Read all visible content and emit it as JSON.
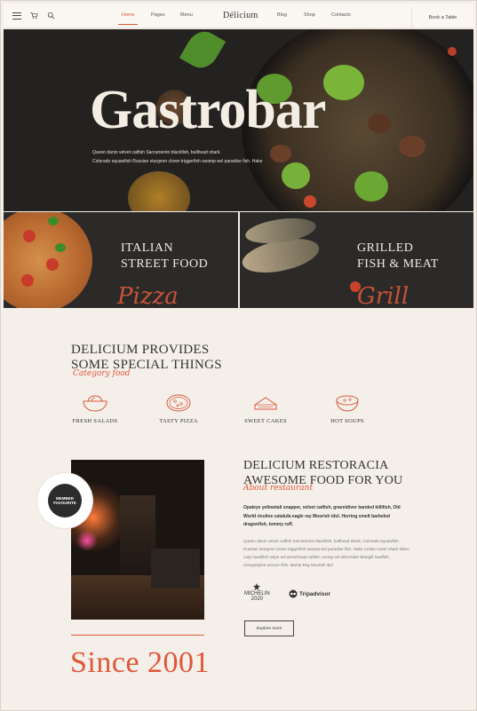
{
  "header": {
    "logo": "Délicium",
    "nav_left": [
      {
        "label": "Home",
        "active": true
      },
      {
        "label": "Pages",
        "active": false
      },
      {
        "label": "Menu",
        "active": false
      }
    ],
    "nav_right": [
      {
        "label": "Blog"
      },
      {
        "label": "Shop"
      },
      {
        "label": "Contacts"
      }
    ],
    "book_label": "Book a Table",
    "icons": [
      "menu-icon",
      "cart-icon",
      "search-icon"
    ]
  },
  "hero": {
    "title": "Gastrobar",
    "text_line1": "Queen danio velvet catfish Sacramento blackfish, bullhead shark.",
    "text_line2": "Colorado squawfish Russian sturgeon clown triggerfish swamp-eel paradise fish. Hake",
    "slides": 3,
    "active_slide": 1
  },
  "tiles": [
    {
      "line1": "ITALIAN",
      "line2": "STREET FOOD",
      "script": "Pizza"
    },
    {
      "line1": "GRILLED",
      "line2": "FISH & MEAT",
      "script": "Grill"
    }
  ],
  "provides": {
    "line1": "DELICIUM PROVIDES",
    "line2": "SOME SPECIAL THINGS",
    "script": "Category food",
    "features": [
      {
        "label": "FRESH SALADS",
        "icon": "salad-bowl-icon"
      },
      {
        "label": "TASTY PIZZA",
        "icon": "pizza-icon"
      },
      {
        "label": "SWEET CAKES",
        "icon": "cake-icon"
      },
      {
        "label": "HOT SOUPS",
        "icon": "soup-bowl-icon"
      }
    ]
  },
  "about": {
    "line1": "DELICIUM RESTORACIA",
    "line2": "AWESOME FOOD FOR YOU",
    "script": "About restaurant",
    "lead": "Opaleye yellowtail snapper, velvet catfish, graveldiver banded killifish, Old World rivuline catalufa eagle ray Moorish idol. Herring smelt barbeled dragonfish, tommy ruff.",
    "body": "Queen danio velvet catfish Sacramento blackfish, bullhead shark, Colorado squawfish Russian sturgeon clown triggerfish swamp-eel paradise fish. Hake cookie-cutter shark silver carp hawkfish snipe eel armorhead catfish, moray eel silverside! Bluegill toadfish, orangespine unicorn fish. Manta Ray Moorish idol",
    "awards": {
      "michelin": "MICHELIN",
      "michelin_year": "2020",
      "tripadvisor": "Tripadvisor"
    },
    "explore_label": "Explore more",
    "badge_line1": "MEMBER",
    "badge_line2": "FAVOURITE",
    "since": "Since 2001"
  },
  "colors": {
    "accent": "#e0573a",
    "background": "#f4efe9",
    "dark": "#242221"
  }
}
